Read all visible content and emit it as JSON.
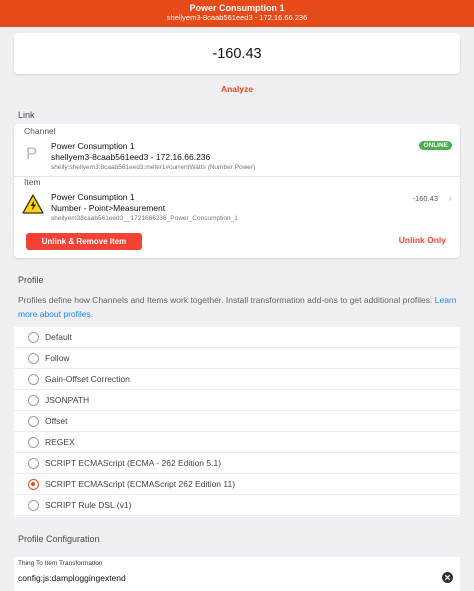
{
  "navbar": {
    "title": "Power Consumption 1",
    "subtitle": "shellyem3-8caab561eed3 - 172.16.66.236"
  },
  "state": {
    "value": "-160.43"
  },
  "analyze": {
    "label": "Analyze"
  },
  "link": {
    "title": "Link",
    "channel": {
      "header": "Channel",
      "icon_letter": "P",
      "name": "Power Consumption 1",
      "thing": "shellyem3-8caab561eed3 - 172.16.66.236",
      "uid": "shelly:shellyem3:8caab561eed3:meter1#currentWatts (Number:Power)",
      "status": "ONLINE",
      "status_color": "#4caf50"
    },
    "item": {
      "header": "Item",
      "icon": "warning-icon",
      "name": "Power Consumption 1",
      "type": "Number - Point>Measurement",
      "uid": "shellyem38caab561eed3__1721666236_Power_Consumption_1",
      "state": "-160.43"
    },
    "buttons": {
      "unlink_remove": "Unlink & Remove Item",
      "unlink_only": "Unlink Only"
    }
  },
  "profile": {
    "title": "Profile",
    "description": "Profiles define how Channels and Items work together. Install transformation add-ons to get additional profiles.",
    "learn_more": "Learn more about profiles.",
    "options": [
      "Default",
      "Follow",
      "Gain-Offset Correction",
      "JSONPATH",
      "Offset",
      "REGEX",
      "SCRIPT ECMAScript (ECMA - 262 Edition 5.1)",
      "SCRIPT ECMAScript (ECMAScript 262 Edition 11)",
      "SCRIPT Rule DSL (v1)"
    ],
    "selected": "SCRIPT ECMAScript (ECMAScript 262 Edition 11)"
  },
  "profile_config": {
    "title": "Profile Configuration",
    "field_label": "Thing To Item Transformation",
    "field_value": "config:js:damploggingextend"
  },
  "colors": {
    "accent": "#e64a19",
    "danger": "#f44336",
    "online": "#4caf50",
    "link": "#1e88e5"
  }
}
